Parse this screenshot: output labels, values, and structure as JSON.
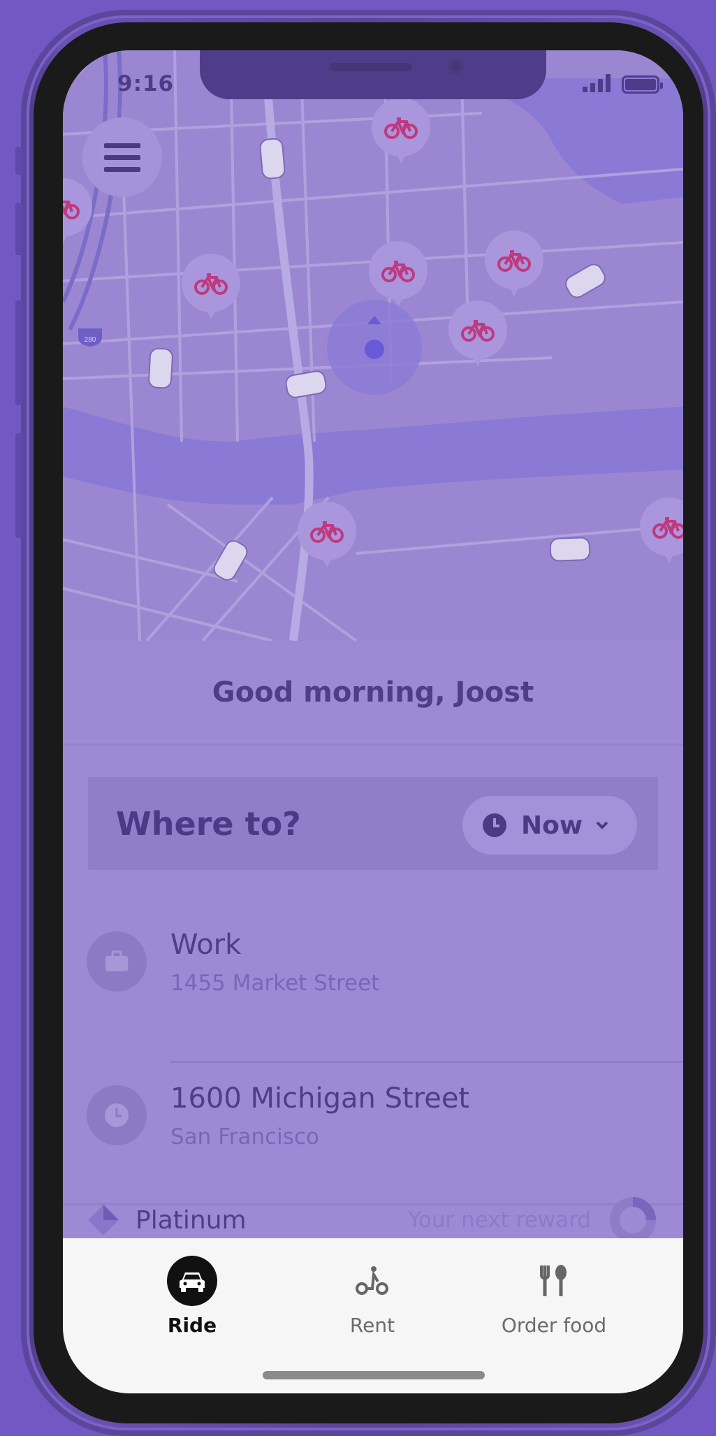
{
  "status_bar": {
    "time": "9:16"
  },
  "map": {
    "interstate_label": "280",
    "bike_pins": 8,
    "car_count": 6
  },
  "greeting": "Good morning, Joost",
  "search": {
    "placeholder": "Where to?",
    "time_option": "Now"
  },
  "saved_places": [
    {
      "title": "Work",
      "subtitle": "1455 Market Street",
      "icon": "briefcase-icon"
    },
    {
      "title": "1600 Michigan Street",
      "subtitle": "San Francisco",
      "icon": "clock-icon"
    }
  ],
  "rewards": {
    "tier": "Platinum",
    "next_reward_label": "Your next reward"
  },
  "tabs": [
    {
      "label": "Ride",
      "icon": "car-icon",
      "active": true
    },
    {
      "label": "Rent",
      "icon": "bike-rent-icon",
      "active": false
    },
    {
      "label": "Order food",
      "icon": "fork-spoon-icon",
      "active": false
    }
  ],
  "colors": {
    "background": "#7357c3",
    "overlay_text": "#4f3d86",
    "bike_pink": "#c23b8a",
    "tabbar_bg": "#f6f6f6"
  }
}
